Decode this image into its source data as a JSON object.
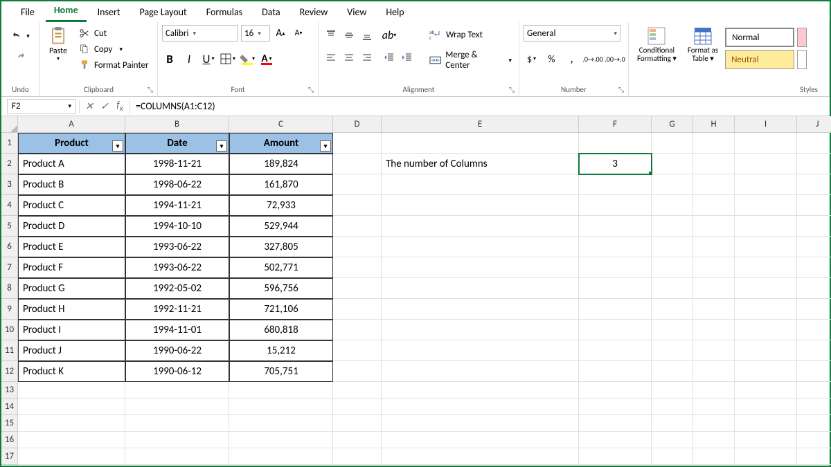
{
  "menu": {
    "tabs": [
      "File",
      "Home",
      "Insert",
      "Page Layout",
      "Formulas",
      "Data",
      "Review",
      "View",
      "Help"
    ],
    "active": 1
  },
  "ribbon": {
    "undo": {
      "label": "Undo"
    },
    "clipboard": {
      "paste": "Paste",
      "cut": "Cut",
      "copy": "Copy",
      "format_painter": "Format Painter",
      "label": "Clipboard"
    },
    "font": {
      "name": "Calibri",
      "size": "16",
      "label": "Font"
    },
    "alignment": {
      "wrap": "Wrap Text",
      "merge": "Merge & Center",
      "label": "Alignment"
    },
    "number": {
      "format": "General",
      "label": "Number"
    },
    "styles": {
      "cond": "Conditional Formatting",
      "table": "Format as Table",
      "normal": "Normal",
      "neutral": "Neutral",
      "label": "Styles"
    }
  },
  "formula_bar": {
    "cell_ref": "F2",
    "formula": "=COLUMNS(A1:C12)"
  },
  "columns": {
    "A": 155,
    "B": 150,
    "C": 150,
    "D": 70,
    "E": 285,
    "F": 105,
    "G": 60,
    "H": 60,
    "I": 90,
    "J": 60
  },
  "row_heights": {
    "header": 30,
    "data": 30,
    "empty": 24
  },
  "table": {
    "headers": [
      "Product",
      "Date",
      "Amount"
    ],
    "rows": [
      [
        "Product A",
        "1998-11-21",
        "189,824"
      ],
      [
        "Product B",
        "1998-06-22",
        "161,870"
      ],
      [
        "Product C",
        "1994-11-21",
        "72,933"
      ],
      [
        "Product D",
        "1994-10-10",
        "529,944"
      ],
      [
        "Product E",
        "1993-06-22",
        "327,805"
      ],
      [
        "Product F",
        "1993-06-22",
        "502,771"
      ],
      [
        "Product G",
        "1992-05-02",
        "596,756"
      ],
      [
        "Product H",
        "1992-11-21",
        "721,106"
      ],
      [
        "Product I",
        "1994-11-01",
        "680,818"
      ],
      [
        "Product J",
        "1990-06-22",
        "15,212"
      ],
      [
        "Product K",
        "1990-06-12",
        "705,751"
      ]
    ]
  },
  "extra": {
    "E2": "The number of Columns",
    "F2": "3"
  }
}
